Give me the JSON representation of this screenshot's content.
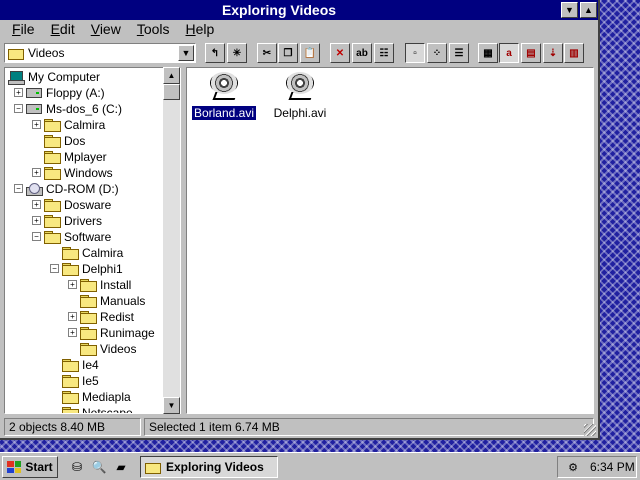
{
  "window": {
    "title": "Exploring Videos"
  },
  "menu": [
    "File",
    "Edit",
    "View",
    "Tools",
    "Help"
  ],
  "toolbar": {
    "address_value": "Videos",
    "buttons": [
      {
        "name": "up-one-level-icon",
        "glyph": "↰"
      },
      {
        "name": "map-network-drive-icon",
        "glyph": "✳"
      },
      {
        "name": "cut-icon",
        "glyph": "✂"
      },
      {
        "name": "copy-icon",
        "glyph": "❐"
      },
      {
        "name": "paste-icon",
        "glyph": "📋"
      },
      {
        "name": "delete-icon",
        "glyph": "✕"
      },
      {
        "name": "rename-icon",
        "glyph": "ab"
      },
      {
        "name": "properties-icon",
        "glyph": "☷"
      },
      {
        "name": "large-icons-icon",
        "glyph": "▫"
      },
      {
        "name": "small-icons-icon",
        "glyph": "⁘"
      },
      {
        "name": "list-view-icon",
        "glyph": "☰"
      },
      {
        "name": "details-view-icon",
        "glyph": "▦"
      },
      {
        "name": "sort-by-name-icon",
        "glyph": "a"
      },
      {
        "name": "sort-by-type-icon",
        "glyph": "▤"
      },
      {
        "name": "sort-by-size-icon",
        "glyph": "⇣"
      },
      {
        "name": "sort-by-date-icon",
        "glyph": "▥"
      }
    ]
  },
  "tree": [
    {
      "label": "My Computer",
      "icon": "computer",
      "level": 0,
      "expander": ""
    },
    {
      "label": "Floppy (A:)",
      "icon": "drive",
      "level": 1,
      "expander": "+"
    },
    {
      "label": "Ms-dos_6 (C:)",
      "icon": "drive",
      "level": 1,
      "expander": "−"
    },
    {
      "label": "Calmira",
      "icon": "folder",
      "level": 2,
      "expander": "+"
    },
    {
      "label": "Dos",
      "icon": "folder",
      "level": 2,
      "expander": ""
    },
    {
      "label": "Mplayer",
      "icon": "folder",
      "level": 2,
      "expander": ""
    },
    {
      "label": "Windows",
      "icon": "folder",
      "level": 2,
      "expander": "+"
    },
    {
      "label": "CD-ROM (D:)",
      "icon": "cdrom",
      "level": 1,
      "expander": "−"
    },
    {
      "label": "Dosware",
      "icon": "folder",
      "level": 2,
      "expander": "+"
    },
    {
      "label": "Drivers",
      "icon": "folder",
      "level": 2,
      "expander": "+"
    },
    {
      "label": "Software",
      "icon": "folder",
      "level": 2,
      "expander": "−"
    },
    {
      "label": "Calmira",
      "icon": "folder",
      "level": 3,
      "expander": ""
    },
    {
      "label": "Delphi1",
      "icon": "folder",
      "level": 3,
      "expander": "−"
    },
    {
      "label": "Install",
      "icon": "folder",
      "level": 4,
      "expander": "+"
    },
    {
      "label": "Manuals",
      "icon": "folder",
      "level": 4,
      "expander": ""
    },
    {
      "label": "Redist",
      "icon": "folder",
      "level": 4,
      "expander": "+"
    },
    {
      "label": "Runimage",
      "icon": "folder",
      "level": 4,
      "expander": "+"
    },
    {
      "label": "Videos",
      "icon": "folder-open",
      "level": 4,
      "expander": ""
    },
    {
      "label": "Ie4",
      "icon": "folder",
      "level": 3,
      "expander": ""
    },
    {
      "label": "Ie5",
      "icon": "folder",
      "level": 3,
      "expander": ""
    },
    {
      "label": "Mediapla",
      "icon": "folder",
      "level": 3,
      "expander": ""
    },
    {
      "label": "Netscape",
      "icon": "folder",
      "level": 3,
      "expander": ""
    }
  ],
  "files": [
    {
      "label": "Borland.avi",
      "selected": true
    },
    {
      "label": "Delphi.avi",
      "selected": false
    }
  ],
  "status": {
    "objects": "2 objects  8.40 MB",
    "selection": "Selected 1 item  6.74 MB"
  },
  "taskbar": {
    "start_label": "Start",
    "task_label": "Exploring Videos",
    "clock": "6:34 PM"
  },
  "colors": {
    "titlebar": "#000080",
    "selection": "#000080",
    "face": "#c0c0c0"
  }
}
